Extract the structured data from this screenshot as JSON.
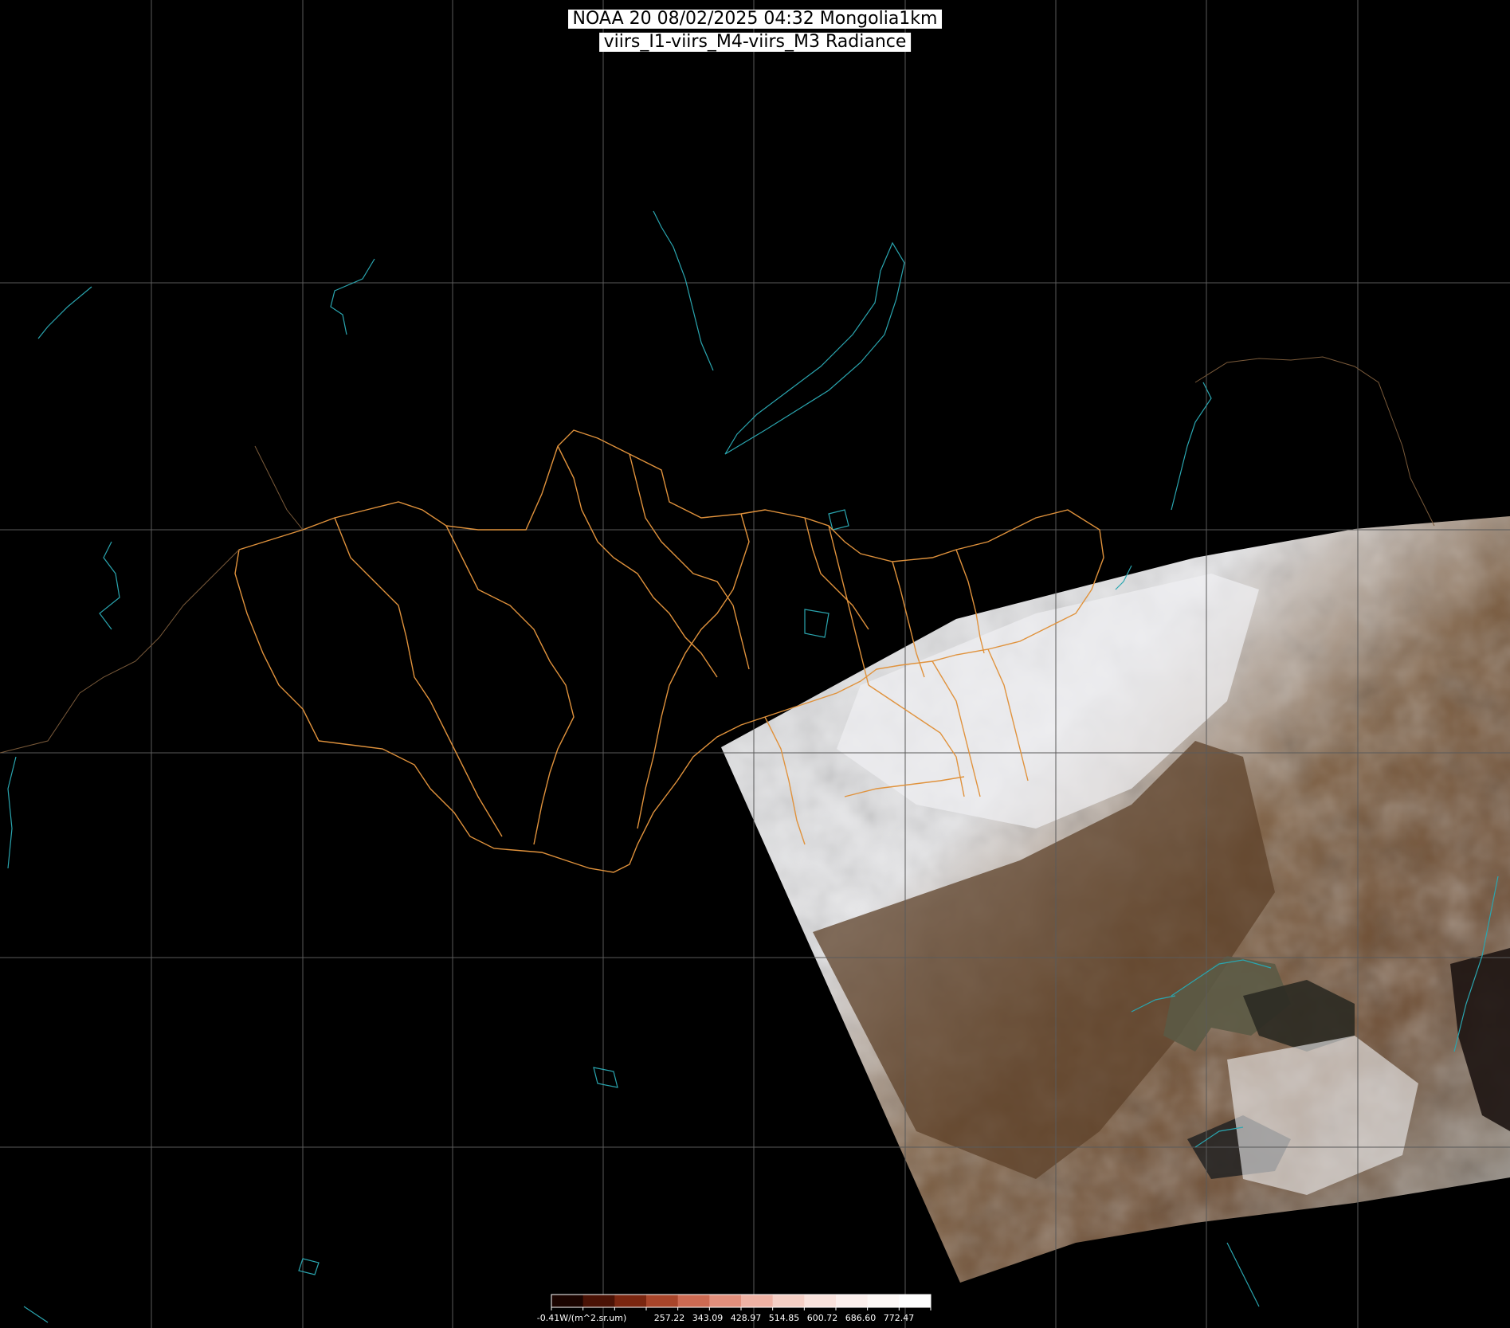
{
  "title": {
    "line1": "NOAA 20 08/02/2025 04:32 Mongolia1km",
    "line2": "viirs_I1-viirs_M4-viirs_M3 Radiance"
  },
  "colorbar": {
    "unit_label": "-0.41W/(m^2.sr.um)",
    "ticks": [
      "257.22",
      "343.09",
      "428.97",
      "514.85",
      "600.72",
      "686.60",
      "772.47"
    ],
    "colors": [
      "#1a0400",
      "#4a1205",
      "#7a2610",
      "#a8452a",
      "#cc6a52",
      "#e28f7c",
      "#efb2a4",
      "#f5cfc5",
      "#f9e2dc",
      "#fbefec",
      "#fdf8f6",
      "#ffffff"
    ]
  },
  "map": {
    "grid_color": "#5a5a5a",
    "coast_color": "#2aa6b0",
    "border_color": "#e0923c",
    "swath_colors": [
      "#e9eaed",
      "#6b4a30",
      "#a8aaa6"
    ],
    "grid_on": true
  }
}
